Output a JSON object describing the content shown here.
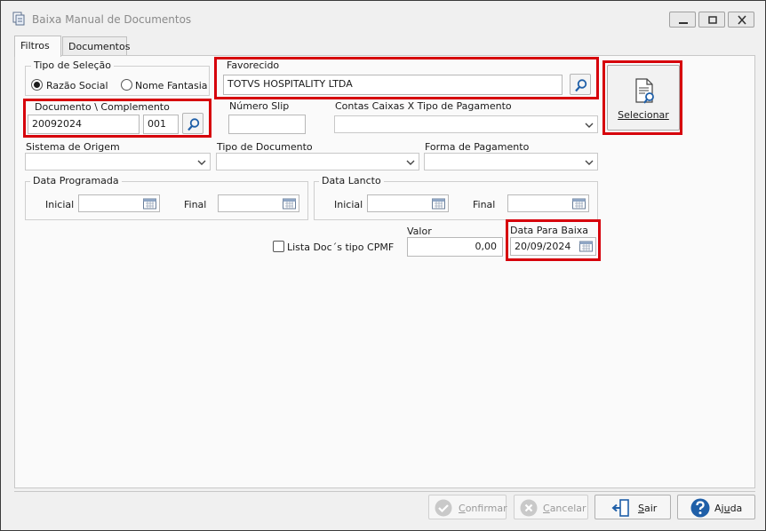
{
  "window": {
    "title": "Baixa Manual de Documentos"
  },
  "tabs": [
    {
      "label": "Filtros"
    },
    {
      "label": "Documentos"
    }
  ],
  "tipo_selecao": {
    "legend": "Tipo de Seleção",
    "opt1": "Razão Social",
    "opt2": "Nome Fantasia",
    "selected": "Razão Social"
  },
  "favorecido": {
    "legend": "Favorecido",
    "value": "TOTVS HOSPITALITY LTDA"
  },
  "selecionar": {
    "label": "Selecionar"
  },
  "documento": {
    "label": "Documento \\ Complemento",
    "numero": "20092024",
    "complemento": "001"
  },
  "numero_slip": {
    "label": "Número Slip",
    "value": ""
  },
  "contas": {
    "label": "Contas Caixas X Tipo de Pagamento",
    "value": ""
  },
  "sistema_origem": {
    "label": "Sistema de Origem",
    "value": ""
  },
  "tipo_documento": {
    "label": "Tipo de Documento",
    "value": ""
  },
  "forma_pagamento": {
    "label": "Forma de Pagamento",
    "value": ""
  },
  "data_programada": {
    "legend": "Data Programada",
    "inicial_label": "Inicial",
    "final_label": "Final",
    "inicial": "",
    "final": ""
  },
  "data_lancto": {
    "legend": "Data Lancto",
    "inicial_label": "Inicial",
    "final_label": "Final",
    "inicial": "",
    "final": ""
  },
  "cpmf": {
    "label": "Lista Doc´s tipo CPMF",
    "checked": false
  },
  "valor": {
    "label": "Valor",
    "value": "0,00"
  },
  "data_baixa": {
    "label": "Data Para Baixa",
    "value": "20/09/2024"
  },
  "buttons": {
    "confirmar_pre": "C",
    "confirmar_rest": "onfirmar",
    "cancelar_pre": "C",
    "cancelar_rest": "ancelar",
    "sair_pre": "S",
    "sair_rest": "air",
    "ajuda_pre": "Aj",
    "ajuda_u": "u",
    "ajuda_rest": "da"
  },
  "colors": {
    "highlight": "#d6000b",
    "accent": "#1f5fa8"
  }
}
